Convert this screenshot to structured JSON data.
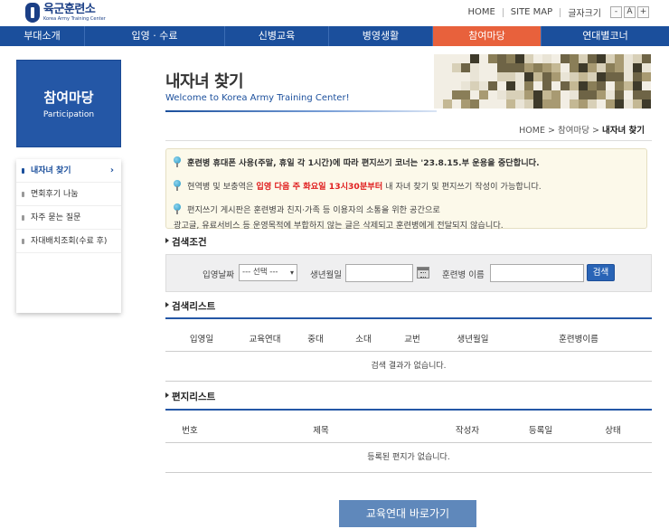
{
  "header": {
    "logo_title": "육군훈련소",
    "logo_sub": "Korea Army Training Center",
    "util_links": [
      "HOME",
      "SITE MAP"
    ],
    "font_size_label": "글자크기",
    "font_buttons": [
      "-",
      "A",
      "+"
    ]
  },
  "gnb": {
    "items": [
      "부대소개",
      "입영 · 수료",
      "신병교육",
      "병영생활",
      "참여마당",
      "연대별코너"
    ],
    "active_index": 4,
    "colors": {
      "bar": "#1b4f9c",
      "active": "#e8613c"
    }
  },
  "lnb": {
    "title": "참여마당",
    "subtitle": "Participation",
    "items": [
      {
        "label": "내자녀 찾기",
        "active": true
      },
      {
        "label": "면회후기 나눔"
      },
      {
        "label": "자주 묻는 질문"
      },
      {
        "label": "자대배치조회(수료 후)"
      }
    ],
    "active_arrow": "›"
  },
  "page": {
    "title": "내자녀 찾기",
    "subtitle": "Welcome to Korea Army Training Center!",
    "breadcrumb": [
      "HOME",
      "참여마당",
      "내자녀 찾기"
    ],
    "breadcrumb_sep": ">"
  },
  "notice": {
    "item1": "훈련병 휴대폰 사용(주말, 휴일 각 1시간)에 따라 편지쓰기 코너는 '23.8.15.부 운용을 중단합니다.",
    "item2_pre": "현역병 및 보충역은 ",
    "item2_red": "입영 다음 주 화요일 13시30분부터",
    "item2_post": " 내 자녀 찾기 및 편지쓰기 작성이 가능합니다.",
    "item3_line1": "편지쓰기 게시판은 훈련병과 친지·가족 등 이용자의 소통을 위한 공간으로",
    "item3_line2": "광고글, 유료서비스 등 운영목적에 부합하지 않는 글은 삭제되고 훈련병에게 전달되지 않습니다."
  },
  "search": {
    "heading": "검색조건",
    "entry_date_label": "입영날짜",
    "entry_date_select": "--- 선택 ---",
    "birth_label": "생년월일",
    "birth_value": "",
    "name_label": "훈련병 이름",
    "name_value": "",
    "button": "검색"
  },
  "result_list": {
    "heading": "검색리스트",
    "columns": [
      "입영일",
      "교육연대",
      "중대",
      "소대",
      "교번",
      "생년월일",
      "훈련병이름"
    ],
    "empty_text": "검색 결과가 없습니다."
  },
  "letter_list": {
    "heading": "편지리스트",
    "columns": [
      "번호",
      "제목",
      "작성자",
      "등록일",
      "상태"
    ],
    "empty_text": "등록된 편지가 없습니다."
  },
  "bottom_button": "교육연대 바로가기"
}
